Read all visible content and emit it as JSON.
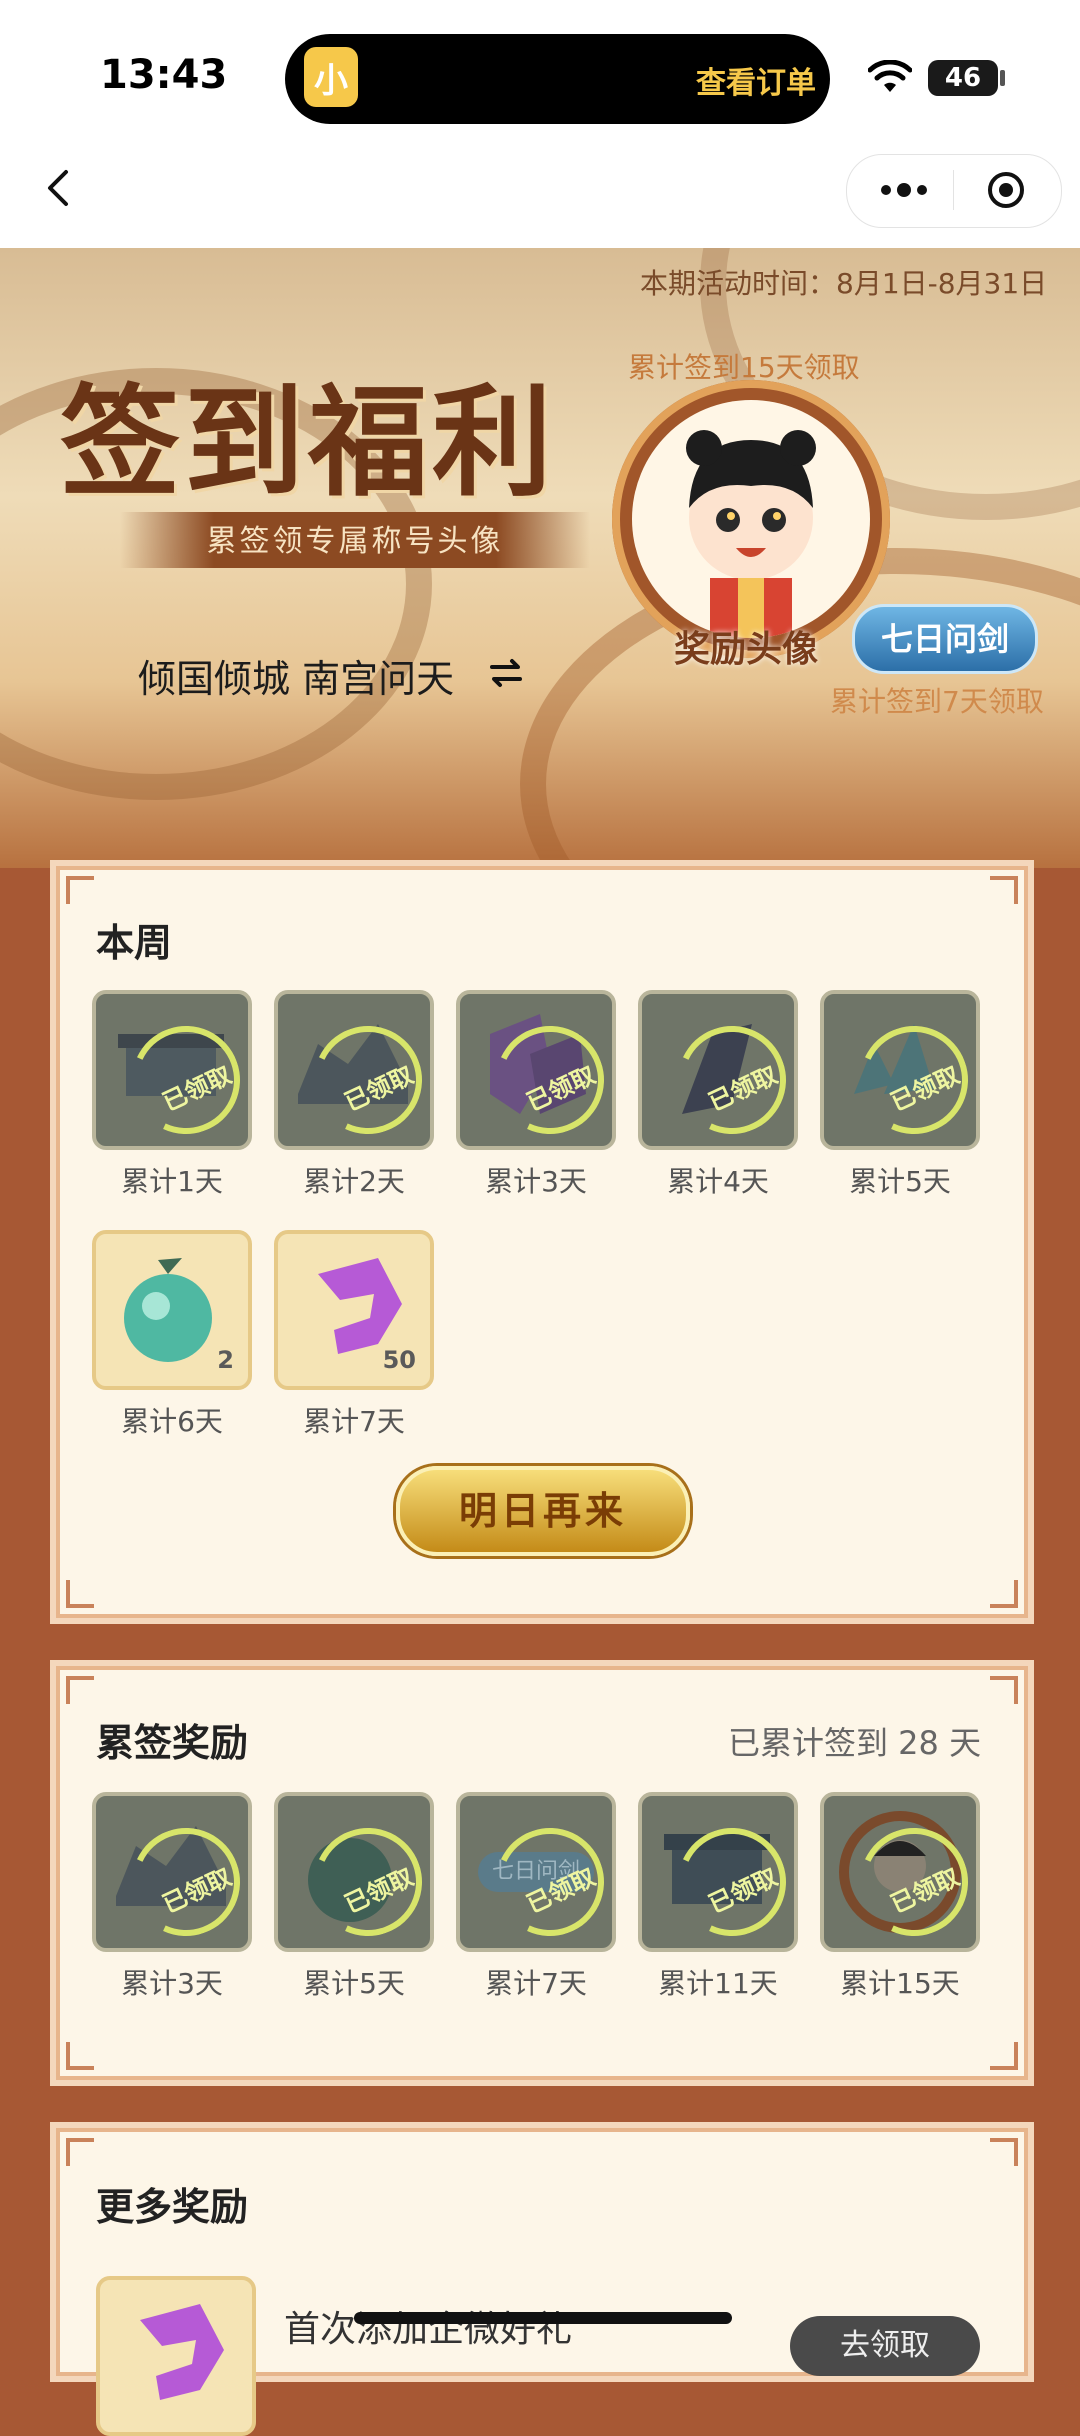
{
  "status_bar": {
    "time": "13:43",
    "island_action": "查看订单",
    "battery": "46",
    "app_icon": "小"
  },
  "nav": {
    "back": "back-arrow-icon",
    "more": "more-dots-icon",
    "close": "target-circle-icon"
  },
  "banner": {
    "period": "本期活动时间：8月1日-8月31日",
    "title": "签到福利",
    "subtitle": "累签领专属称号头像",
    "avatar_hint": "累计签到15天领取",
    "avatar_label": "奖励头像",
    "title_badge": "七日问剑",
    "title_badge_hint": "累计签到7天领取",
    "character": "倾国倾城 南宫问天",
    "switch_icon": "⇌"
  },
  "week": {
    "title": "本周",
    "stamp": "已领取",
    "items": [
      {
        "label": "累计1天",
        "claimed": true
      },
      {
        "label": "累计2天",
        "claimed": true
      },
      {
        "label": "累计3天",
        "claimed": true
      },
      {
        "label": "累计4天",
        "claimed": true
      },
      {
        "label": "累计5天",
        "claimed": true
      },
      {
        "label": "累计6天",
        "claimed": false,
        "count": "2"
      },
      {
        "label": "累计7天",
        "claimed": false,
        "count": "50"
      }
    ],
    "button": "明日再来"
  },
  "cumulative": {
    "title": "累签奖励",
    "total": "已累计签到 28 天",
    "stamp": "已领取",
    "items": [
      {
        "label": "累计3天"
      },
      {
        "label": "累计5天"
      },
      {
        "label": "累计7天",
        "badge": "七日问剑"
      },
      {
        "label": "累计11天"
      },
      {
        "label": "累计15天"
      }
    ]
  },
  "more": {
    "title": "更多奖励",
    "first_item": "首次添加企微好礼",
    "button": "去领取"
  },
  "colors": {
    "accent": "#a75834",
    "card_bg": "#fdf6e8",
    "stamp": "#d8e56a"
  }
}
